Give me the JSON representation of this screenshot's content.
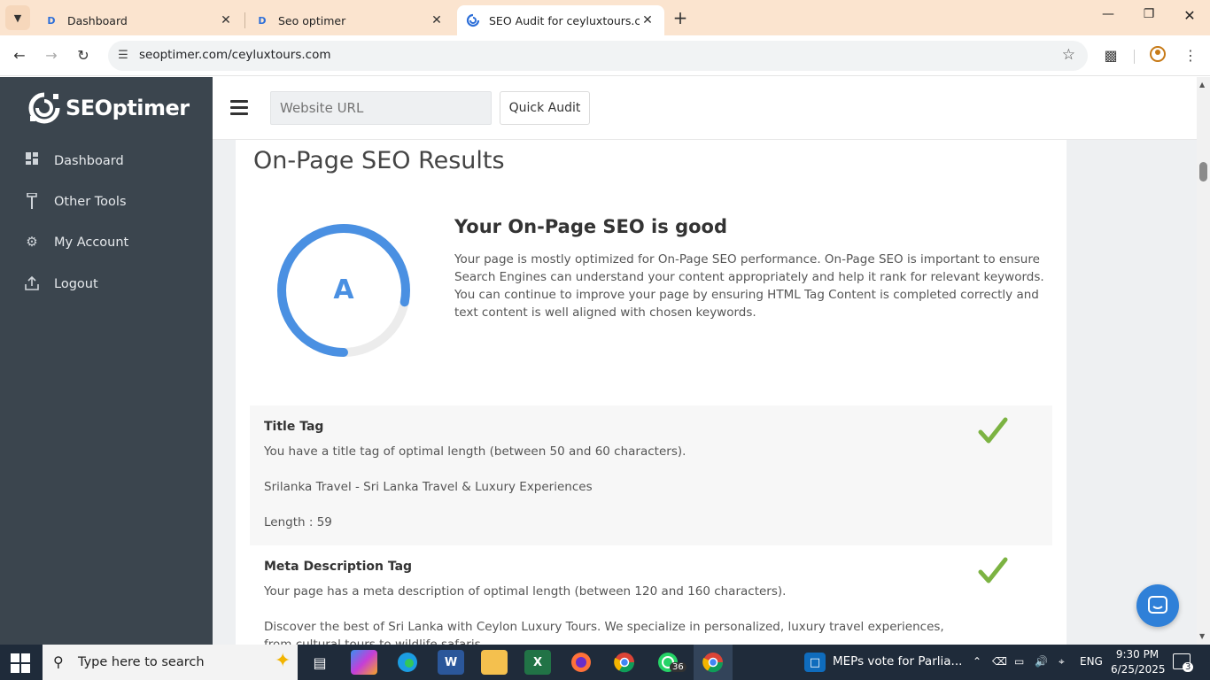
{
  "browser": {
    "tabs": [
      {
        "label": "Dashboard",
        "active": false
      },
      {
        "label": "Seo optimer",
        "active": false
      },
      {
        "label": "SEO Audit for ceyluxtours.com",
        "active": true
      }
    ],
    "address": "seoptimer.com/ceyluxtours.com"
  },
  "app": {
    "logo": "SEOptimer",
    "sidebar": [
      {
        "label": "Dashboard",
        "icon": "dashboard-icon"
      },
      {
        "label": "Other Tools",
        "icon": "tools-icon"
      },
      {
        "label": "My Account",
        "icon": "gear-icon"
      },
      {
        "label": "Logout",
        "icon": "logout-icon"
      }
    ],
    "header": {
      "url_placeholder": "Website URL",
      "audit_label": "Quick Audit"
    }
  },
  "results": {
    "title": "On-Page SEO Results",
    "grade": "A",
    "score_fraction": 0.78,
    "summary_heading": "Your On-Page SEO is good",
    "summary_text": "Your page is mostly optimized for On-Page SEO performance. On-Page SEO is important to ensure Search Engines can understand your content appropriately and help it rank for relevant keywords. You can continue to improve your page by ensuring HTML Tag Content is completed correctly and text content is well aligned with chosen keywords.",
    "title_tag": {
      "heading": "Title Tag",
      "status": "You have a title tag of optimal length (between 50 and 60 characters).",
      "value": "Srilanka Travel - Sri Lanka Travel & Luxury Experiences",
      "length": "Length : 59"
    },
    "meta_tag": {
      "heading": "Meta Description Tag",
      "status": "Your page has a meta description of optimal length (between 120 and 160 characters).",
      "value": "Discover the best of Sri Lanka with Ceylon Luxury Tours. We specialize in personalized, luxury travel experiences, from cultural tours to wildlife safaris."
    }
  },
  "taskbar": {
    "search_placeholder": "Type here to search",
    "news": "MEPs vote for Parlia...",
    "whatsapp_badge": "36",
    "lang": "ENG",
    "time": "9:30 PM",
    "date": "6/25/2025",
    "notifications": "3"
  },
  "colors": {
    "sidebar": "#3b454e",
    "accent_blue": "#4a90e2",
    "check_green": "#7cb342"
  }
}
